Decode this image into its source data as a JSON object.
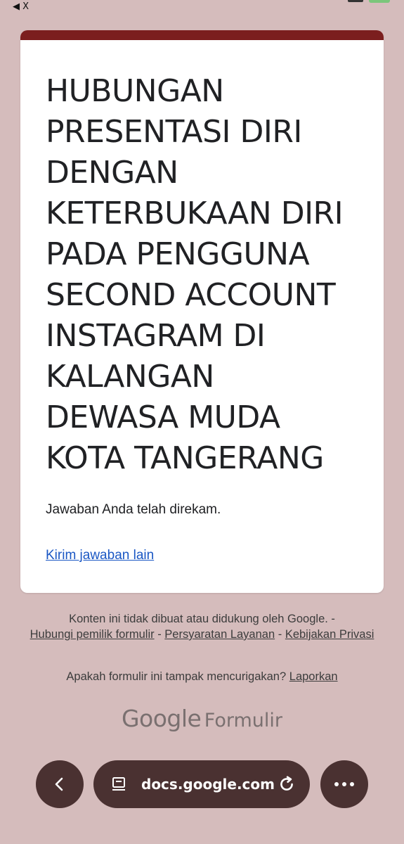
{
  "status_bar": {
    "back_app_label": "◀ X"
  },
  "form": {
    "title": "HUBUNGAN\nPRESENTASI DIRI\nDENGAN\nKETERBUKAAN DIRI\nPADA PENGGUNA\nSECOND ACCOUNT\nINSTAGRAM DI\nKALANGAN\nDEWASA MUDA\nKOTA TANGERANG",
    "confirmation": "Jawaban Anda telah direkam.",
    "submit_another_link": "Kirim jawaban lain",
    "accent_color": "#7b1e1e"
  },
  "footer": {
    "disclaimer": "Konten ini tidak dibuat atau didukung oleh Google. -",
    "contact_owner_link": "Hubungi pemilik formulir",
    "separator": " - ",
    "terms_link": "Persyaratan Layanan",
    "privacy_link": "Kebijakan Privasi",
    "report_question": "Apakah formulir ini tampak mencurigakan?",
    "report_link": "Laporkan",
    "brand_google": "Google",
    "brand_product": "Formulir"
  },
  "browser": {
    "url": "docs.google.com",
    "icons": {
      "back": "chevron-left-icon",
      "page": "page-info-icon",
      "reload": "reload-icon",
      "more": "more-horizontal-icon"
    },
    "bar_color": "#4a3131"
  }
}
